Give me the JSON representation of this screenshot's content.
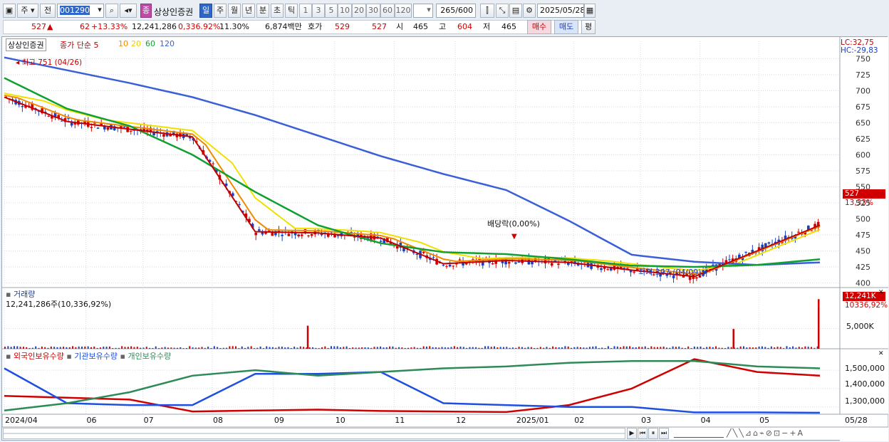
{
  "toolbar": {
    "market_label": "주",
    "prev_label": "전",
    "code": "001290",
    "name": "상상인증권",
    "jong_label": "종",
    "periods": [
      "일",
      "주",
      "월",
      "년",
      "분",
      "초",
      "틱"
    ],
    "active_period": "일",
    "intervals": [
      "1",
      "3",
      "5",
      "10",
      "20",
      "30",
      "60",
      "120"
    ],
    "count": "265",
    "count_total": "/600",
    "date": "2025/05/28"
  },
  "quote": {
    "price": "527",
    "change": "62",
    "change_pct": "+13.33%",
    "volume": "12,241,286",
    "volume_pct": "0,336.92%",
    "turnover": "11.30%",
    "amount": "6,874백만",
    "bid_label": "호가",
    "ask": "529",
    "bid": "527",
    "open_label": "시",
    "open": "465",
    "high_label": "고",
    "high": "604",
    "low_label": "저",
    "low": "465",
    "buy_label": "매수",
    "sell_label": "매도",
    "eval_label": "평"
  },
  "price_panel": {
    "legend_name": "상상인증권",
    "legend_ma_title": "종가 단순 5",
    "ma_labels": [
      "10",
      "20",
      "60",
      "120"
    ],
    "lc_label": "LC:32,75",
    "hc_label": "HC:-29,83",
    "high_marker": "최고 751 (04/26)",
    "low_marker": "최저 397 (04/09)",
    "dividend_marker": "배당락(0,00%)",
    "last_price_tag": "527",
    "last_pct_tag": "13,33%",
    "y_ticks": [
      "750",
      "725",
      "700",
      "675",
      "650",
      "625",
      "600",
      "575",
      "550",
      "525",
      "500",
      "475",
      "450",
      "425",
      "400"
    ]
  },
  "volume_panel": {
    "title": "거래량",
    "value_text": "12,241,286주(10,336,92%)",
    "tag_value": "12,241K",
    "tag_pct": "10336,92%",
    "y_tick": "5,000K"
  },
  "holding_panel": {
    "series_names": [
      "외국인보유수량",
      "기관보유수량",
      "개인보유수량"
    ],
    "y_ticks": [
      "1,500,000",
      "1,400,000",
      "1,300,000"
    ]
  },
  "x_axis": {
    "labels": [
      "2024/04",
      "06",
      "07",
      "08",
      "09",
      "10",
      "11",
      "12",
      "2025/01",
      "02",
      "03",
      "04",
      "05"
    ],
    "right_label": "05/28"
  },
  "colors": {
    "up": "#d00000",
    "down": "#1a3fbf",
    "ma5": "#c00000",
    "ma10": "#f08a00",
    "ma20": "#f0e000",
    "ma60": "#10a030",
    "ma120": "#3a5fd8",
    "foreign": "#d00000",
    "institution": "#1f4fe0",
    "individual": "#2e8b57"
  },
  "chart_data": [
    {
      "type": "line",
      "title": "상상인증권",
      "series": [
        {
          "name": "120",
          "x": [
            "2024/04",
            "06",
            "07",
            "08",
            "09",
            "10",
            "11",
            "12",
            "2025/01",
            "02",
            "03",
            "04",
            "05",
            "05/28"
          ],
          "values": [
            752,
            732,
            712,
            690,
            662,
            630,
            598,
            570,
            545,
            497,
            444,
            433,
            428,
            432
          ]
        },
        {
          "name": "60",
          "x": [
            "2024/04",
            "06",
            "07",
            "08",
            "09",
            "10",
            "11",
            "12",
            "2025/01",
            "02",
            "03",
            "04",
            "05",
            "05/28"
          ],
          "values": [
            720,
            672,
            645,
            600,
            542,
            490,
            462,
            448,
            445,
            437,
            427,
            425,
            428,
            437
          ]
        },
        {
          "name": "5",
          "x": [
            "2024/04",
            "06",
            "07",
            "08",
            "09",
            "10",
            "11",
            "12",
            "2025/01",
            "02",
            "03",
            "04",
            "05",
            "05/28"
          ],
          "values": [
            690,
            652,
            640,
            628,
            480,
            478,
            470,
            430,
            435,
            432,
            420,
            410,
            450,
            490
          ]
        }
      ],
      "ylim": [
        395,
        755
      ]
    },
    {
      "type": "bar",
      "title": "거래량",
      "categories": [
        "2024/09",
        "2025/04",
        "05/28"
      ],
      "values": [
        5700000,
        4900000,
        12241286
      ]
    },
    {
      "type": "line",
      "series": [
        {
          "name": "외국인보유수량",
          "x": [
            "2024/04",
            "06",
            "07",
            "08",
            "09",
            "10",
            "11",
            "12",
            "2025/01",
            "02",
            "03",
            "04",
            "05",
            "05/28"
          ],
          "values": [
            1360000,
            1350000,
            1340000,
            1275000,
            1280000,
            1285000,
            1278000,
            1275000,
            1272000,
            1310000,
            1400000,
            1560000,
            1490000,
            1470000
          ]
        },
        {
          "name": "기관보유수량",
          "x": [
            "2024/04",
            "06",
            "07",
            "08",
            "09",
            "10",
            "11",
            "12",
            "2025/01",
            "02",
            "03",
            "04",
            "05",
            "05/28"
          ],
          "values": [
            1510000,
            1320000,
            1310000,
            1310000,
            1480000,
            1480000,
            1490000,
            1320000,
            1310000,
            1300000,
            1300000,
            1270000,
            1270000,
            1268000
          ]
        },
        {
          "name": "개인보유수량",
          "x": [
            "2024/04",
            "06",
            "07",
            "08",
            "09",
            "10",
            "11",
            "12",
            "2025/01",
            "02",
            "03",
            "04",
            "05",
            "05/28"
          ],
          "values": [
            1280000,
            1320000,
            1380000,
            1470000,
            1500000,
            1470000,
            1490000,
            1510000,
            1520000,
            1540000,
            1550000,
            1550000,
            1520000,
            1510000
          ]
        }
      ],
      "ylim": [
        1260000,
        1570000
      ]
    }
  ]
}
